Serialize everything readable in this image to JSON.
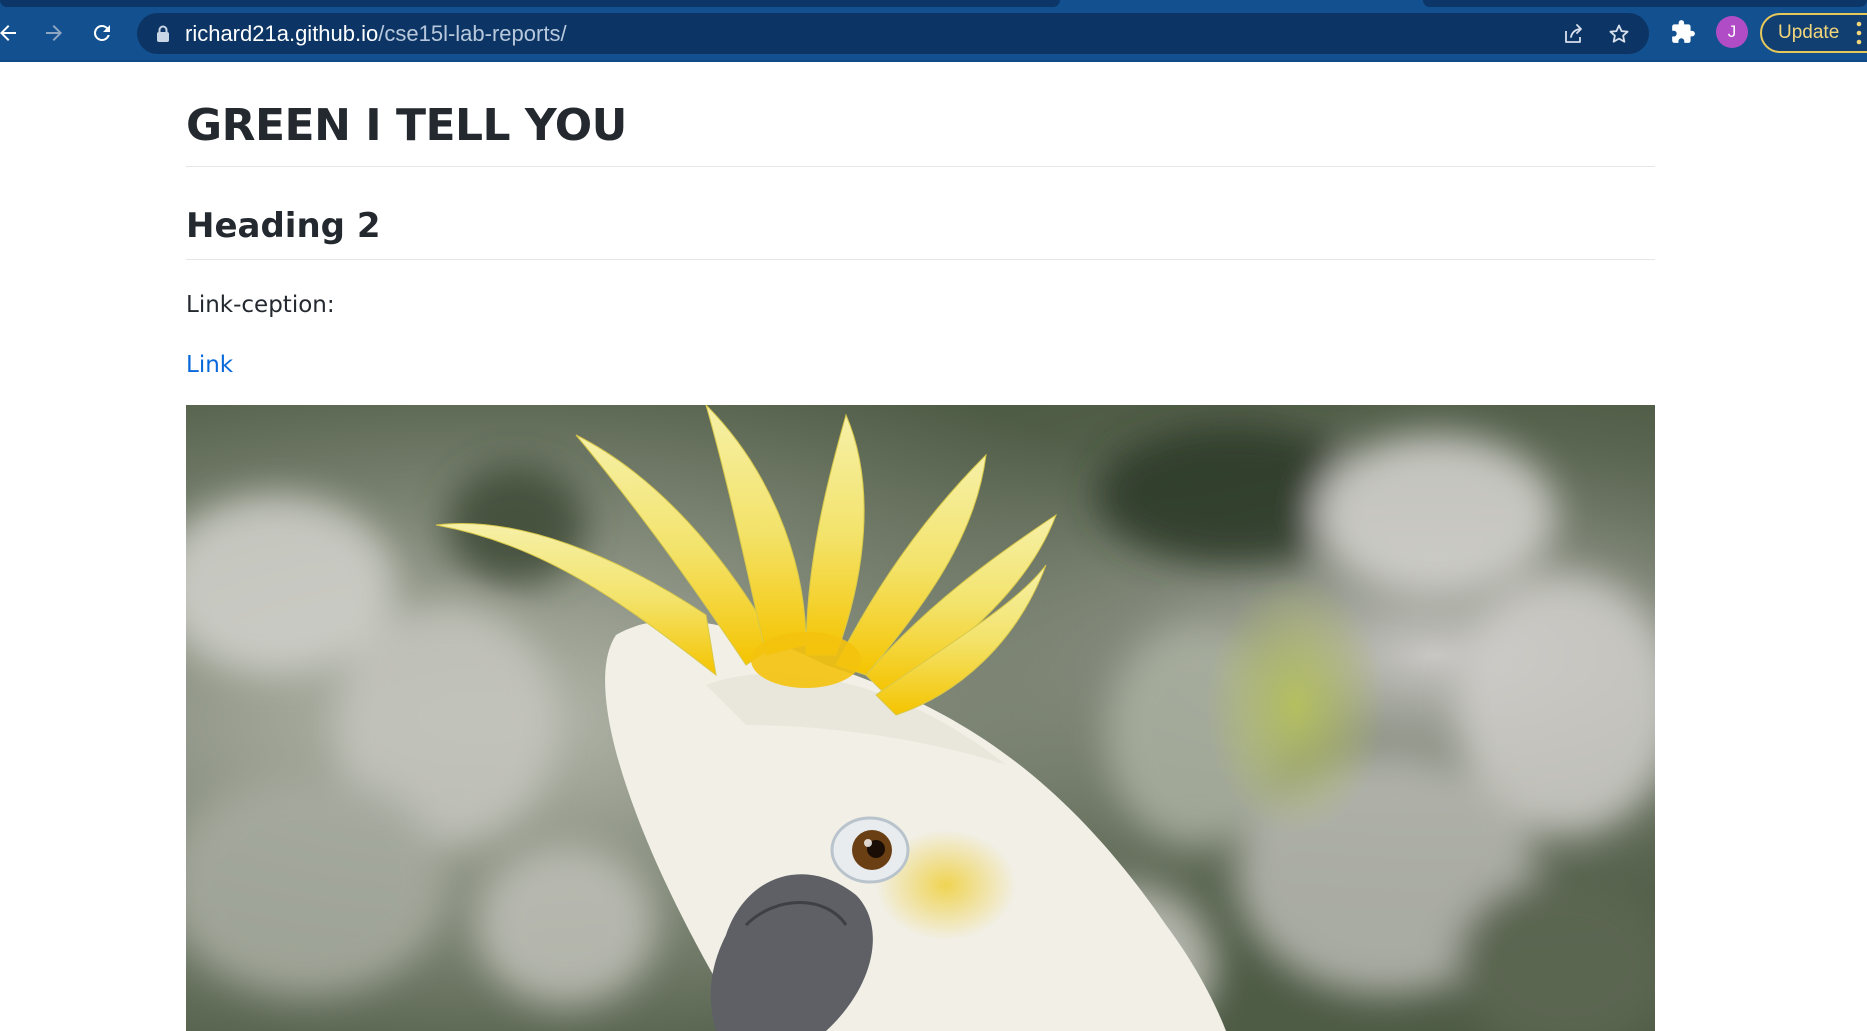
{
  "browser": {
    "url_host": "richard21a.github.io",
    "url_path": "/cse15l-lab-reports/",
    "avatar_initial": "J",
    "update_label": "Update",
    "icons": [
      "back-icon",
      "forward-icon",
      "reload-icon",
      "lock-icon",
      "share-icon",
      "star-icon",
      "extensions-icon",
      "menu-dots-icon"
    ]
  },
  "page": {
    "title": "GREEN I TELL YOU",
    "heading2": "Heading 2",
    "paragraph": "Link-ception:",
    "link_text": "Link",
    "image_subject": "cockatoo-photo"
  },
  "colors": {
    "toolbar": "#13508f",
    "omnibox": "#0c3565",
    "link": "#0969da",
    "text": "#24292f",
    "update_border": "#e7c95a",
    "avatar": "#b04dc6"
  }
}
